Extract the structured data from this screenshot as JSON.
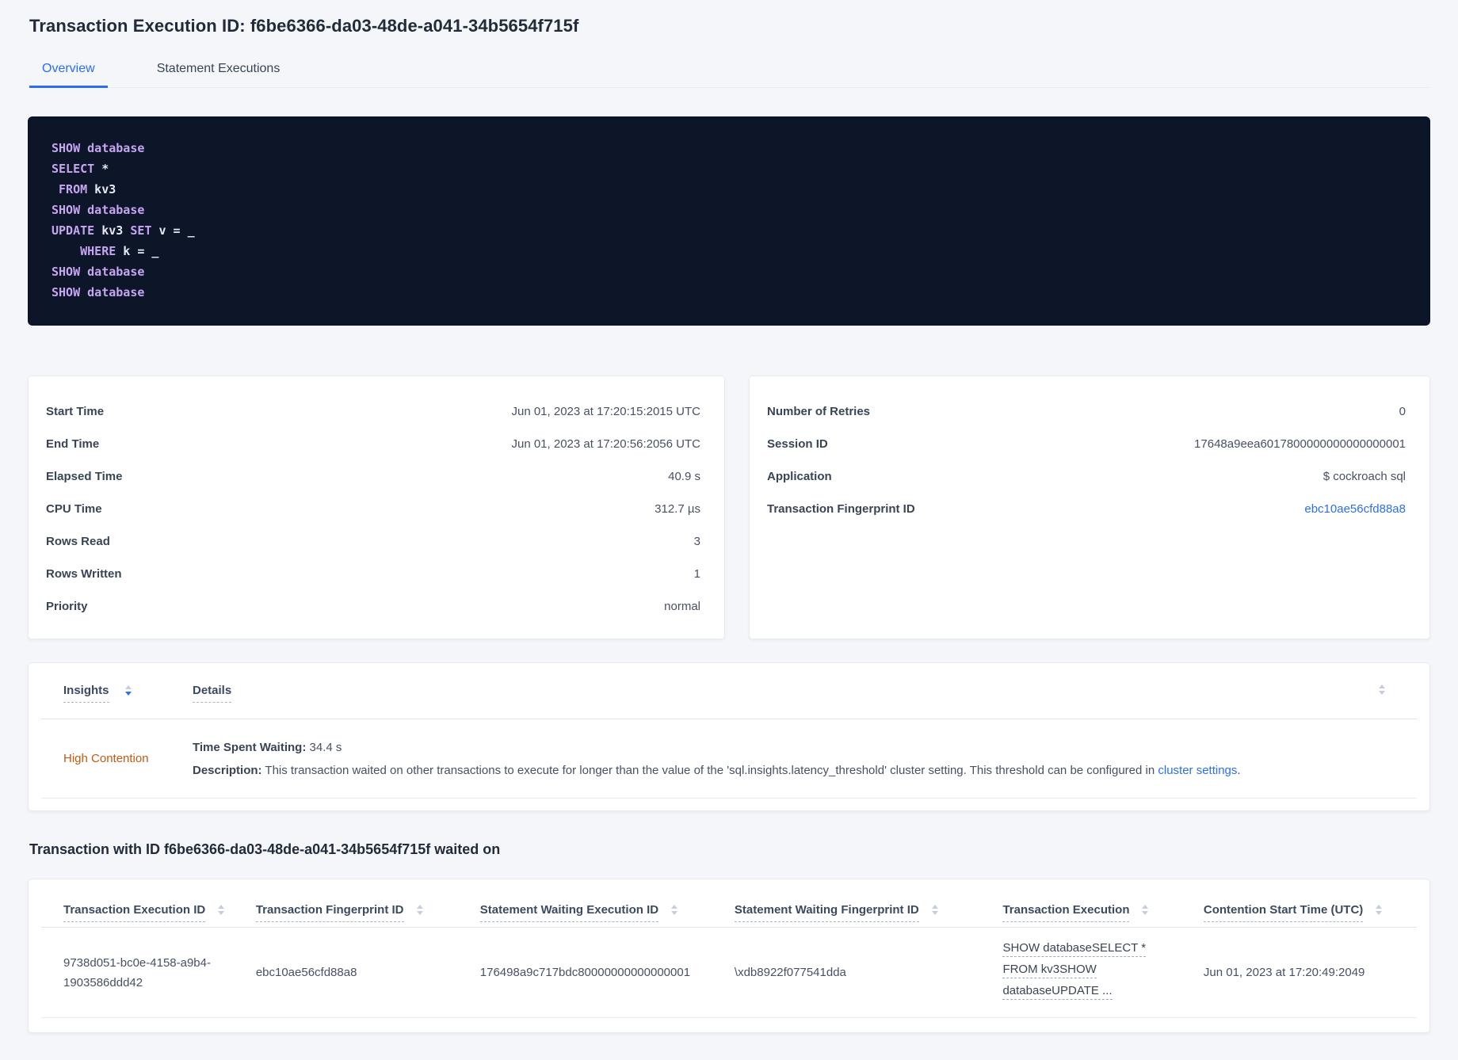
{
  "page": {
    "title": "Transaction Execution ID: f6be6366-da03-48de-a041-34b5654f715f"
  },
  "tabs": {
    "overview": "Overview",
    "statement_executions": "Statement Executions"
  },
  "sql": {
    "l1": [
      "SHOW database"
    ],
    "l2": [
      "SELECT",
      " *"
    ],
    "l3": [
      " ",
      "FROM",
      " kv3"
    ],
    "l4": [
      "SHOW database"
    ],
    "l5": [
      "UPDATE",
      " kv3 ",
      "SET",
      " v = _"
    ],
    "l6": [
      "    ",
      "WHERE",
      " k = _"
    ],
    "l7": [
      "SHOW database"
    ],
    "l8": [
      "SHOW database"
    ]
  },
  "summary_left": {
    "rows": [
      {
        "label": "Start Time",
        "value": "Jun 01, 2023 at 17:20:15:2015 UTC"
      },
      {
        "label": "End Time",
        "value": "Jun 01, 2023 at 17:20:56:2056 UTC"
      },
      {
        "label": "Elapsed Time",
        "value": "40.9 s"
      },
      {
        "label": "CPU Time",
        "value": "312.7 µs"
      },
      {
        "label": "Rows Read",
        "value": "3"
      },
      {
        "label": "Rows Written",
        "value": "1"
      },
      {
        "label": "Priority",
        "value": "normal"
      }
    ]
  },
  "summary_right": {
    "rows": [
      {
        "label": "Number of Retries",
        "value": "0"
      },
      {
        "label": "Session ID",
        "value": "17648a9eea6017800000000000000001"
      },
      {
        "label": "Application",
        "value": "$ cockroach sql"
      },
      {
        "label": "Transaction Fingerprint ID",
        "value": "ebc10ae56cfd88a8"
      }
    ]
  },
  "insights": {
    "col_insights": "Insights",
    "col_details": "Details",
    "row": {
      "insight": "High Contention",
      "waiting_label": "Time Spent Waiting:",
      "waiting_value": "34.4 s",
      "description_label": "Description:",
      "description_text": "This transaction waited on other transactions to execute for longer than the value of the 'sql.insights.latency_threshold' cluster setting. This threshold can be configured in ",
      "description_link": "cluster settings",
      "description_suffix": "."
    }
  },
  "waited_on": {
    "heading": "Transaction with ID f6be6366-da03-48de-a041-34b5654f715f waited on",
    "columns": [
      "Transaction Execution ID",
      "Transaction Fingerprint ID",
      "Statement Waiting Execution ID",
      "Statement Waiting Fingerprint ID",
      "Transaction Execution",
      "Contention Start Time (UTC)"
    ],
    "row": {
      "txn_execution_id": "9738d051-bc0e-4158-a9b4-1903586ddd42",
      "txn_fingerprint_id": "ebc10ae56cfd88a8",
      "stmt_waiting_execution_id": "176498a9c717bdc80000000000000001",
      "stmt_waiting_fingerprint_id": "\\xdb8922f077541dda",
      "txn_execution_lines": [
        "SHOW databaseSELECT *",
        "FROM kv3SHOW",
        "databaseUPDATE ..."
      ],
      "contention_start": "Jun 01, 2023 at 17:20:49:2049"
    }
  },
  "colors": {
    "accent_blue": "#2b6ef2",
    "insight_orange": "#c05b12",
    "code_background": "#0d1628",
    "code_keyword": "#c6a5f1",
    "code_plain": "#e6e9f4",
    "page_background": "#f4f6fa"
  }
}
